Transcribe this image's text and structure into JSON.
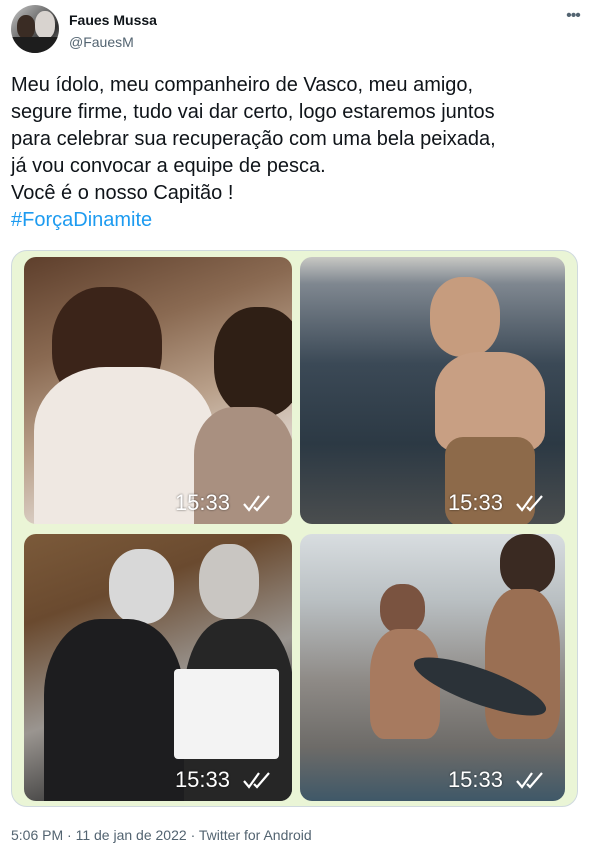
{
  "author": {
    "display_name": "Faues Mussa",
    "handle": "@FauesM"
  },
  "menu_icon": "more-horizontal-icon",
  "tweet_text": {
    "lines": [
      "Meu ídolo, meu companheiro de Vasco, meu amigo,",
      "segure firme, tudo vai dar certo, logo estaremos juntos",
      "para celebrar sua recuperação com uma bela peixada,",
      "já vou convocar a equipe de pesca.",
      "Você é o nosso Capitão !"
    ],
    "hashtag": "#ForçaDinamite"
  },
  "media": {
    "photos": [
      {
        "timestamp": "15:33",
        "icon": "double-check-icon"
      },
      {
        "timestamp": "15:33",
        "icon": "double-check-icon"
      },
      {
        "timestamp": "15:33",
        "icon": "double-check-icon"
      },
      {
        "timestamp": "15:33",
        "icon": "double-check-icon"
      }
    ]
  },
  "footer": {
    "time": "5:06 PM",
    "separator": "·",
    "date": "11 de jan de 2022",
    "source": "Twitter for Android"
  },
  "colors": {
    "text": "#0f1419",
    "secondary": "#536471",
    "link": "#1d9bf0",
    "media_background": "#eaf5d6"
  }
}
